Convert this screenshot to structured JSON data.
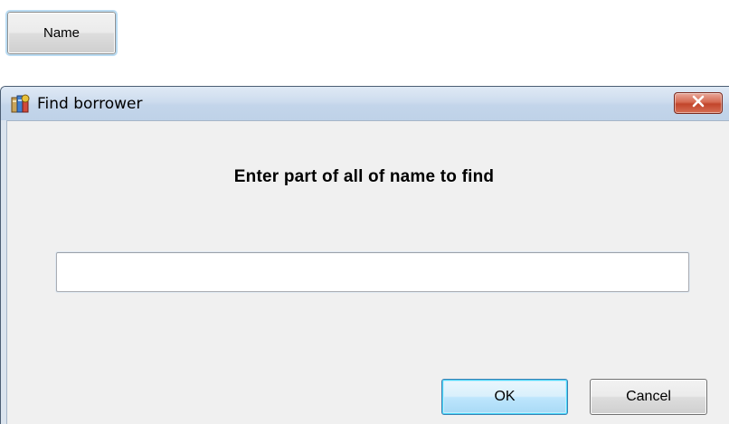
{
  "top_button": {
    "label": "Name"
  },
  "dialog": {
    "title": "Find borrower",
    "title_icon": "library-books-icon",
    "close_icon": "close-x-icon",
    "prompt": "Enter part of all of name to find",
    "search_input": {
      "value": "",
      "placeholder": ""
    },
    "ok_label": "OK",
    "cancel_label": "Cancel"
  },
  "colors": {
    "titlebar": "#c8d9ec",
    "close_button": "#c8462c",
    "client_background": "#f0f0f0",
    "ok_focus": "#3c7fb1"
  }
}
